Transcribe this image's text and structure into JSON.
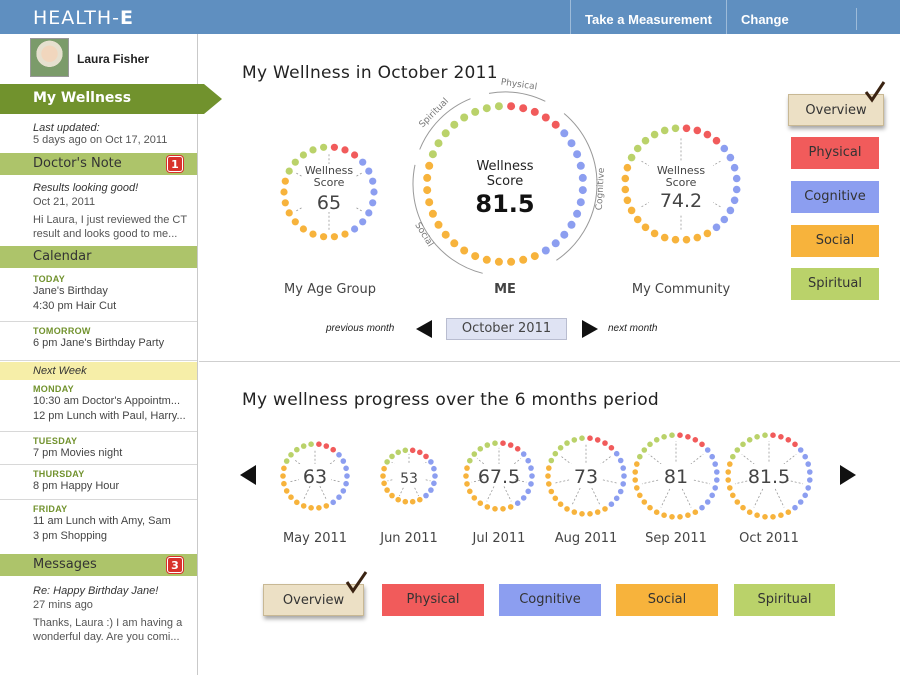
{
  "header": {
    "brand_main": "HEALTH-",
    "brand_bold": "E",
    "nav": [
      "Take a Measurement",
      "Change Settings"
    ]
  },
  "sidebar": {
    "user_name": "Laura Fisher",
    "my_wellness": "My Wellness",
    "last_updated_label": "Last updated:",
    "last_updated_value": "5 days ago on Oct 17, 2011",
    "doctors_note": {
      "title": "Doctor's Note",
      "badge": "1",
      "subject": "Results looking good!",
      "date": "Oct 21, 2011",
      "body_1": "Hi Laura, I just reviewed the CT",
      "body_2": "result and looks good to me..."
    },
    "calendar": {
      "title": "Calendar",
      "days": [
        {
          "name": "TODAY",
          "events": [
            "Jane's Birthday",
            "4:30 pm  Hair Cut"
          ]
        },
        {
          "name": "TOMORROW",
          "events": [
            "6 pm  Jane's Birthday Party"
          ]
        }
      ],
      "next_week": "Next Week",
      "week_days": [
        {
          "name": "MONDAY",
          "events": [
            "10:30 am  Doctor's Appointm...",
            "12 pm  Lunch with Paul, Harry..."
          ]
        },
        {
          "name": "TUESDAY",
          "events": [
            "7 pm  Movies night"
          ]
        },
        {
          "name": "THURSDAY",
          "events": [
            "8 pm  Happy Hour"
          ]
        },
        {
          "name": "FRIDAY",
          "events": [
            "11 am  Lunch with Amy, Sam",
            "3 pm  Shopping"
          ]
        }
      ]
    },
    "messages": {
      "title": "Messages",
      "badge": "3",
      "subject": "Re: Happy Birthday Jane!",
      "time": "27 mins ago",
      "body_1": "Thanks, Laura :) I am having a",
      "body_2": "wonderful day. Are you comi..."
    }
  },
  "wellness": {
    "title": "My Wellness in October 2011",
    "score_label_1": "Wellness",
    "score_label_2": "Score",
    "age_group": {
      "score": "65",
      "caption": "My Age Group"
    },
    "me": {
      "score": "81.5",
      "caption": "ME",
      "segments": [
        "Spiritual",
        "Physical",
        "Cognitive",
        "Social"
      ]
    },
    "community": {
      "score": "74.2",
      "caption": "My Community"
    },
    "prev_month": "previous month",
    "next_month": "next month",
    "current_month": "October 2011"
  },
  "filters": [
    "Overview",
    "Physical",
    "Cognitive",
    "Social",
    "Spiritual"
  ],
  "progress": {
    "title": "My wellness progress over the 6 months period",
    "months": [
      {
        "label": "May 2011",
        "score": "63"
      },
      {
        "label": "Jun 2011",
        "score": "53"
      },
      {
        "label": "Jul 2011",
        "score": "67.5"
      },
      {
        "label": "Aug 2011",
        "score": "73"
      },
      {
        "label": "Sep 2011",
        "score": "81"
      },
      {
        "label": "Oct 2011",
        "score": "81.5"
      }
    ]
  },
  "colors": {
    "header": "#5f8fc0",
    "accent_green": "#71922d",
    "section_green": "#adc46a",
    "physical": "#f15b5b",
    "cognitive": "#8c9ef0",
    "social": "#f7b33c",
    "spiritual": "#bad26a",
    "overview": "#ece0c5",
    "badge": "#d8322b"
  },
  "icons": [
    "checkmark-icon",
    "arrow-left-icon",
    "arrow-right-icon"
  ]
}
